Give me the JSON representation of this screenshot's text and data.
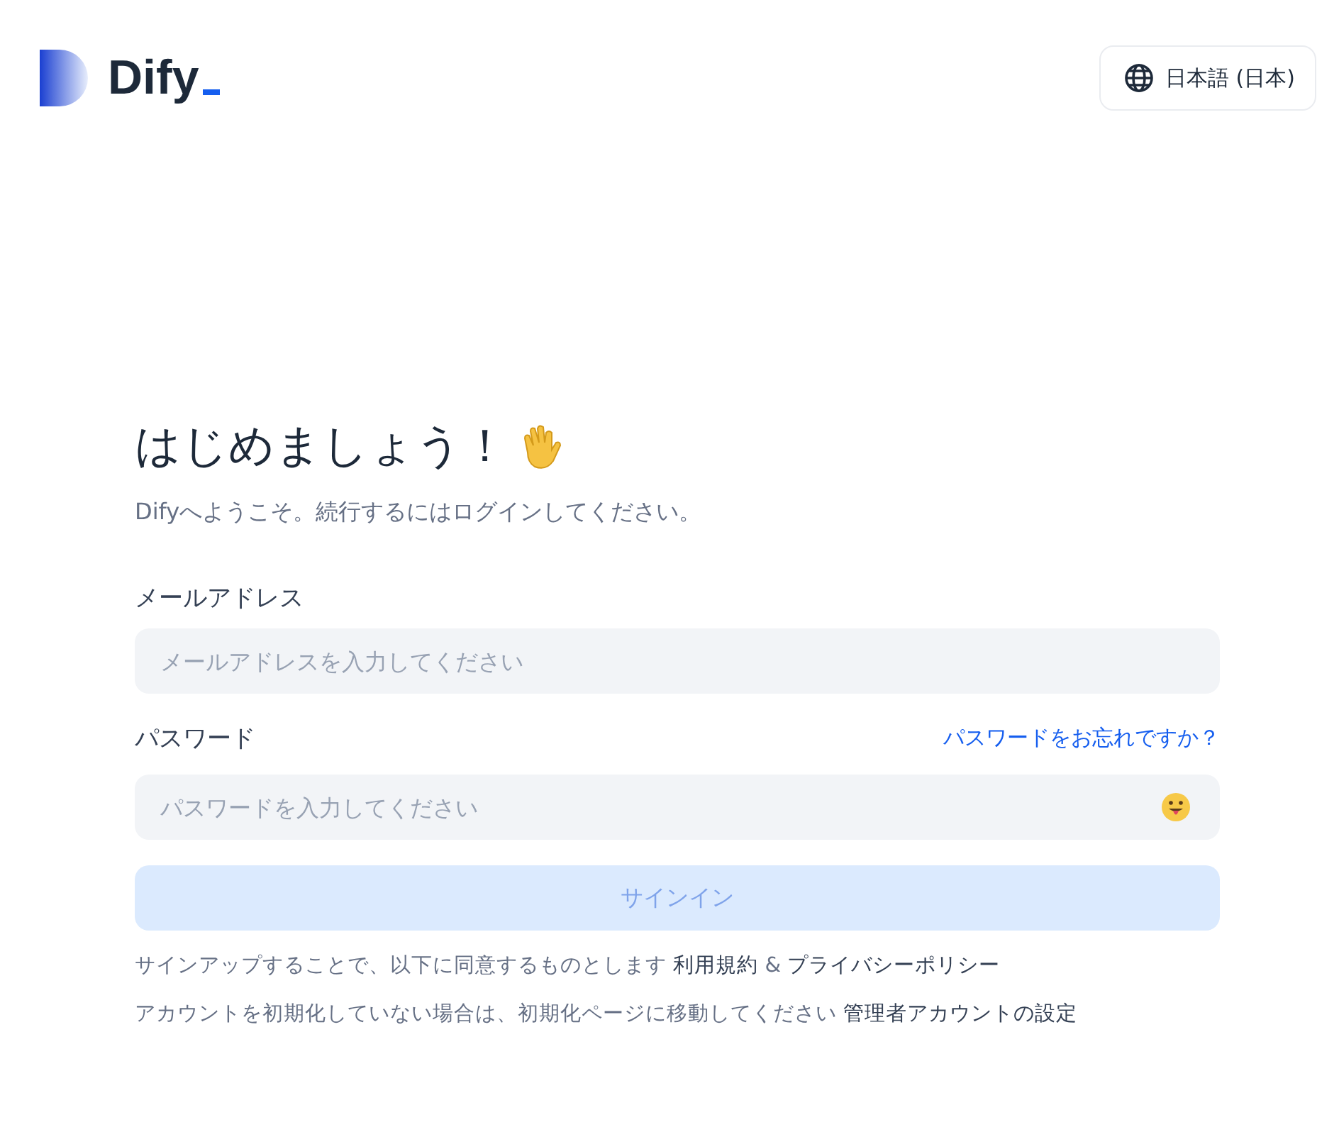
{
  "header": {
    "logo": "Dify",
    "language": "日本語 (日本)"
  },
  "title": "はじめましょう！",
  "subtitle": "Difyへようこそ。続行するにはログインしてください。",
  "email": {
    "label": "メールアドレス",
    "placeholder": "メールアドレスを入力してください"
  },
  "password": {
    "label": "パスワード",
    "forgot_link": "パスワードをお忘れですか？",
    "placeholder": "パスワードを入力してください"
  },
  "sign_in_button": {
    "label": "サインイン",
    "disabled": true
  },
  "notes": [
    [
      {
        "kind": "text",
        "text": "サインアップすることで、以下に同意するものとします "
      },
      {
        "kind": "link",
        "text": "利用規約"
      },
      {
        "kind": "text",
        "text": " & "
      },
      {
        "kind": "link",
        "text": "プライバシーポリシー"
      }
    ],
    [
      {
        "kind": "text",
        "text": "アカウントを初期化していない場合は、初期化ページに移動してください "
      },
      {
        "kind": "link",
        "text": "管理者アカウントの設定"
      }
    ]
  ]
}
